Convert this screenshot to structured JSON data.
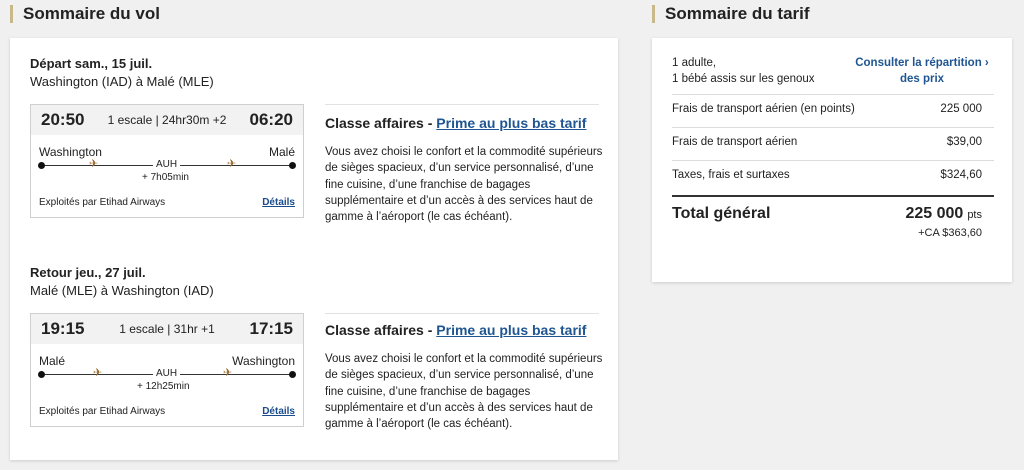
{
  "flight_summary": {
    "title": "Sommaire du vol",
    "legs": [
      {
        "date": "Départ sam., 15 juil.",
        "route": "Washington (IAD) à Malé (MLE)",
        "depart_time": "20:50",
        "arrive_time": "06:20",
        "stops": "1 escale | 24hr30m +2",
        "origin_city": "Washington",
        "dest_city": "Malé",
        "hub": "AUH",
        "layover": "+ 7h05min",
        "operated_by": "Exploités par Etihad Airways",
        "details_label": "Détails",
        "fare_class": "Classe affaires - ",
        "fare_link": "Prime au plus bas tarif",
        "fare_desc": "Vous avez choisi le confort et la commodité supérieurs de sièges spacieux, d’un service personnalisé, d’une fine cuisine, d’une franchise de bagages supplémentaire et d’un accès à des services haut de gamme à l’aéroport (le cas échéant)."
      },
      {
        "date": "Retour jeu., 27 juil.",
        "route": "Malé (MLE) à Washington (IAD)",
        "depart_time": "19:15",
        "arrive_time": "17:15",
        "stops": "1 escale | 31hr +1",
        "origin_city": "Malé",
        "dest_city": "Washington",
        "hub": "AUH",
        "layover": "+ 12h25min",
        "operated_by": "Exploités par Etihad Airways",
        "details_label": "Détails",
        "fare_class": "Classe affaires - ",
        "fare_link": "Prime au plus bas tarif",
        "fare_desc": "Vous avez choisi le confort et la commodité supérieurs de sièges spacieux, d’un service personnalisé, d’une fine cuisine, d’une franchise de bagages supplémentaire et d’un accès à des services haut de gamme à l’aéroport (le cas échéant)."
      }
    ]
  },
  "fare_summary": {
    "title": "Sommaire du tarif",
    "passengers_line1": "1 adulte,",
    "passengers_line2": "1 bébé assis sur les genoux",
    "breakdown_link_line1": "Consulter la répartition ›",
    "breakdown_link_line2": "des prix",
    "rows": [
      {
        "label": "Frais de transport aérien (en points)",
        "value": "225 000"
      },
      {
        "label": "Frais de transport aérien",
        "value": "$39,00"
      },
      {
        "label": "Taxes, frais et surtaxes",
        "value": "$324,60"
      }
    ],
    "total_label": "Total général",
    "total_points": "225 000",
    "total_points_unit": "pts",
    "total_cash": "+CA $363,60"
  },
  "icons": {
    "plane": "airplane-icon",
    "chevron": "chevron-right-icon"
  },
  "colors": {
    "link": "#1f5591",
    "accent_bar": "#c9b98a",
    "plane_icon": "#9c6a2e"
  }
}
